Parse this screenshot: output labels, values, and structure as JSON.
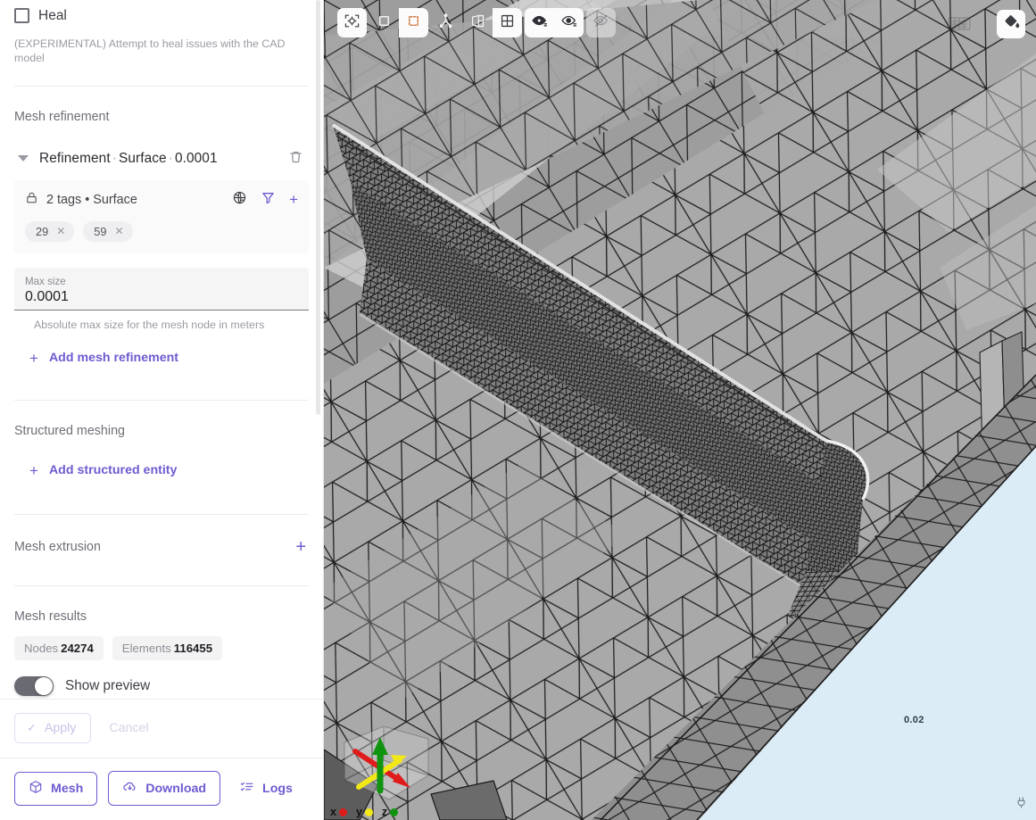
{
  "sidebar": {
    "heal": {
      "label": "Heal",
      "checked": false,
      "help": "(EXPERIMENTAL) Attempt to heal issues with the CAD model"
    },
    "mesh_refinement": {
      "title": "Mesh refinement",
      "refinement": {
        "name": "Refinement",
        "type": "Surface",
        "value": "0.0001",
        "separator": "·",
        "delete_icon": "trash-icon",
        "caret_icon": "caret-down-icon"
      },
      "tags": {
        "lock_icon": "lock-icon",
        "summary": "2 tags • Surface",
        "globe_icon": "globe-icon",
        "filter_icon": "filter-icon",
        "add_icon": "plus-icon",
        "chips": [
          {
            "label": "29",
            "remove": "✕"
          },
          {
            "label": "59",
            "remove": "✕"
          }
        ]
      },
      "max_size": {
        "label": "Max size",
        "value": "0.0001",
        "placeholder": "0.0001",
        "help": "Absolute max size for the mesh node in meters"
      },
      "add_link": "Add mesh refinement"
    },
    "structured_meshing": {
      "title": "Structured meshing",
      "add_link": "Add structured entity"
    },
    "mesh_extrusion": {
      "title": "Mesh extrusion",
      "add_icon": "plus-icon"
    },
    "mesh_results": {
      "title": "Mesh results",
      "nodes_label": "Nodes",
      "nodes_value": "24274",
      "elements_label": "Elements",
      "elements_value": "116455",
      "preview_label": "Show preview",
      "preview_on": true
    },
    "apply_bar": {
      "apply_label": "Apply",
      "apply_disabled": true,
      "cancel_label": "Cancel",
      "check_icon": "check-icon"
    },
    "footer": {
      "mesh_label": "Mesh",
      "mesh_icon": "cube-icon",
      "download_label": "Download",
      "download_icon": "cloud-download-icon",
      "logs_label": "Logs",
      "logs_icon": "list-checks-icon"
    }
  },
  "viewport": {
    "toolbar": [
      {
        "name": "fit-to-view-button",
        "icon": "fit-view-icon",
        "state": "on"
      },
      {
        "name": "select-solid-button",
        "icon": "square-solid-icon",
        "state": "off"
      },
      {
        "name": "box-select-button",
        "icon": "square-dashed-icon",
        "state": "on"
      },
      {
        "name": "select-node-button",
        "icon": "node-branch-icon",
        "state": "off"
      },
      {
        "name": "clip-plane-button",
        "icon": "clip-plane-icon",
        "state": "off"
      },
      {
        "name": "grid-button",
        "icon": "grid-icon",
        "state": "on"
      },
      {
        "name": "visibility-button",
        "icon": "eye-mesh-icon",
        "state": "on"
      },
      {
        "name": "visibility-alt-button",
        "icon": "eye-mesh-alt-icon",
        "state": "on"
      },
      {
        "name": "hidden-toggle-button",
        "icon": "eye-off-icon",
        "state": "dim"
      }
    ],
    "paint_button_icon": "paint-bucket-icon",
    "ghost_icon": "keyboard-icon",
    "scale_label": "0.02",
    "plug_icon": "plug-icon",
    "axes": {
      "gizmo_icon": "axis-gizmo-icon",
      "items": [
        {
          "label": "x",
          "color": "#e01b1b"
        },
        {
          "label": "y",
          "color": "#f2e815"
        },
        {
          "label": "z",
          "color": "#109410"
        }
      ]
    },
    "colors": {
      "background_gray": "#9c9c9c",
      "background_blue": "#dcecf6",
      "mesh_line": "#1c1c1c",
      "accent": "#6d5bd0"
    }
  }
}
